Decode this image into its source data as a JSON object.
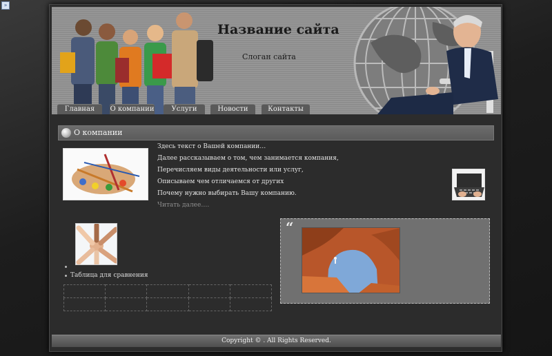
{
  "header": {
    "site_title": "Название сайта",
    "site_slogan": "Слоган сайта"
  },
  "nav": {
    "items": [
      {
        "label": "Главная"
      },
      {
        "label": "О компании"
      },
      {
        "label": "Услуги"
      },
      {
        "label": "Новости"
      },
      {
        "label": "Контакты"
      }
    ]
  },
  "content": {
    "section_title": "О компании",
    "lines": [
      "Здесь текст о Вашей компании…",
      "Далее рассказываем о том, чем занимается компания,",
      "Перечисляем виды деятельности или услуг,",
      "Описываем чем отличаемся от других",
      "Почему нужно выбирать Вашу компанию."
    ],
    "read_more": "Читать далее….",
    "list_item": "Таблица для сравнения",
    "quote_mark": "“"
  },
  "footer": {
    "copyright": "Copyright © .    All Rights Reserved."
  },
  "colors": {
    "page_bg": "#2c2c2c",
    "header_bg": "#9a9a9a",
    "nav_tab": "#5a5a5a",
    "quote_box": "#707070"
  }
}
